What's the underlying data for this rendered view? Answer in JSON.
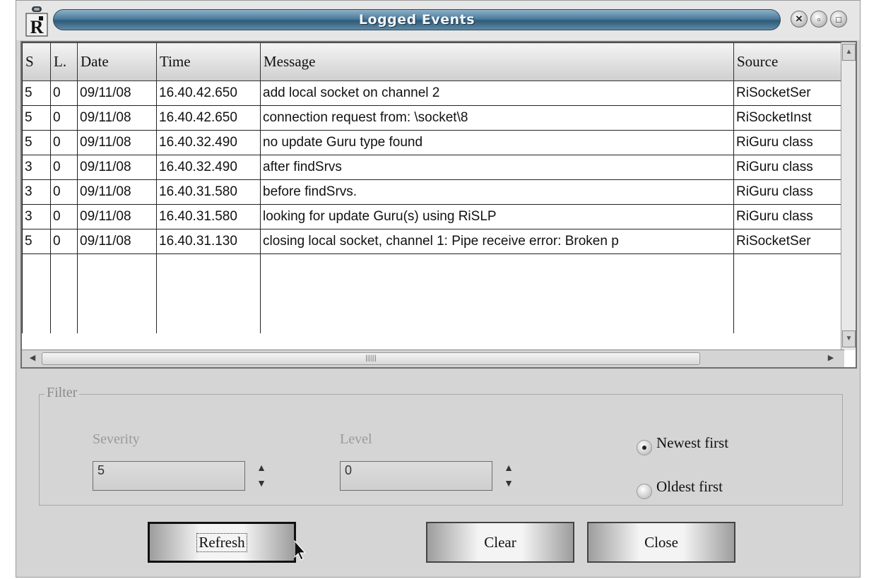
{
  "window": {
    "title": "Logged Events"
  },
  "colors": {
    "title_bar": "#4d7c9c",
    "background": "#d5d5d5"
  },
  "table": {
    "columns": [
      "S",
      "L.",
      "Date",
      "Time",
      "Message",
      "Source"
    ],
    "rows": [
      [
        "5",
        "0",
        "09/11/08",
        "16.40.42.650",
        "add local socket on channel 2",
        "RiSocketSer"
      ],
      [
        "5",
        "0",
        "09/11/08",
        "16.40.42.650",
        "connection request from: \\socket\\8",
        "RiSocketInst"
      ],
      [
        "5",
        "0",
        "09/11/08",
        "16.40.32.490",
        "no update Guru type found",
        "RiGuru class"
      ],
      [
        "3",
        "0",
        "09/11/08",
        "16.40.32.490",
        "after findSrvs",
        "RiGuru class"
      ],
      [
        "3",
        "0",
        "09/11/08",
        "16.40.31.580",
        "before findSrvs.",
        "RiGuru class"
      ],
      [
        "3",
        "0",
        "09/11/08",
        "16.40.31.580",
        "looking for update Guru(s) using RiSLP",
        "RiGuru class"
      ],
      [
        "5",
        "0",
        "09/11/08",
        "16.40.31.130",
        "closing local socket, channel 1: Pipe receive error: Broken p",
        "RiSocketSer"
      ]
    ]
  },
  "filter": {
    "legend": "Filter",
    "severity_label": "Severity",
    "severity_value": "5",
    "level_label": "Level",
    "level_value": "0",
    "order_options": [
      "Newest first",
      "Oldest first"
    ],
    "order_selected": "Newest first"
  },
  "buttons": {
    "refresh": "Refresh",
    "clear": "Clear",
    "close": "Close"
  },
  "icons": [
    "app-icon",
    "close-icon",
    "minimize-icon",
    "maximize-icon",
    "scroll-up-icon",
    "scroll-down-icon",
    "scroll-left-icon",
    "scroll-right-icon",
    "spin-up-icon",
    "spin-down-icon",
    "mouse-cursor-icon"
  ]
}
